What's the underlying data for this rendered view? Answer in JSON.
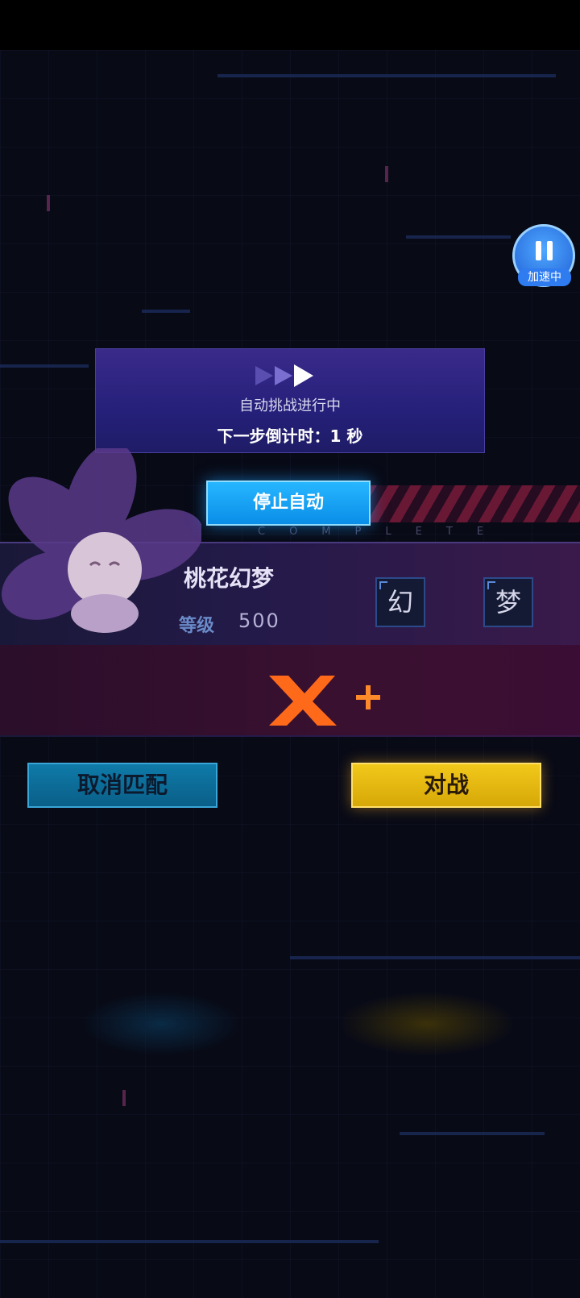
{
  "accelerator": {
    "label": "加速中",
    "icon": "pause-icon"
  },
  "auto_panel": {
    "status": "自动挑战进行中",
    "countdown": "下一步倒计时：1 秒",
    "icon": "fast-forward-icon"
  },
  "stop_button": {
    "label": "停止自动"
  },
  "banner": {
    "subtitle": "COMPLETE"
  },
  "player": {
    "name": "桃花幻梦",
    "level_label": "等级",
    "level_value": "500",
    "tags": [
      "幻",
      "梦"
    ]
  },
  "actions": {
    "cancel_label": "取消匹配",
    "battle_label": "对战"
  },
  "colors": {
    "stop_button": "#0a8ee8",
    "cancel_button": "#0a5f88",
    "battle_button": "#f2c81a",
    "panel": "#25207a"
  }
}
